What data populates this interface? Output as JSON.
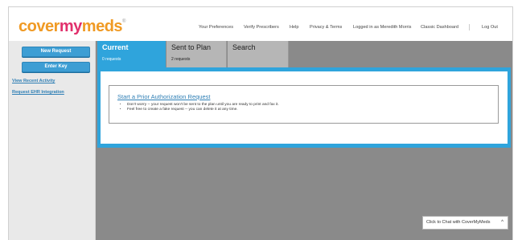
{
  "logo": {
    "part1": "cover",
    "part2": "my",
    "part3": "meds",
    "mark": "®"
  },
  "nav": {
    "preferences": "Your Preferences",
    "verify": "Verify Prescribers",
    "help": "Help",
    "privacy": "Privacy & Terms",
    "logged_in": "Logged in as Meredith Morris",
    "classic": "Classic Dashboard",
    "logout": "Log Out"
  },
  "sidebar": {
    "new_request": "New Request",
    "enter_key": "Enter Key",
    "view_recent": "View Recent Activity",
    "ehr": "Request EHR Integration"
  },
  "tabs": [
    {
      "title": "Current",
      "sub": "0 requests"
    },
    {
      "title": "Sent to Plan",
      "sub": "2 requests"
    },
    {
      "title": "Search",
      "sub": ""
    }
  ],
  "panel": {
    "link": "Start a Prior Authorization Request",
    "bullets": [
      "Don't worry -- your request won't be sent to the plan until you are ready to print and fax it.",
      "Feel free to create a fake request -- you can delete it at any time."
    ]
  },
  "chat": {
    "label": "Click to Chat with CoverMyMeds",
    "caret": "^"
  },
  "colors": {
    "accent": "#2fa4dc",
    "logo_orange": "#f09a24",
    "logo_pink": "#e1306c",
    "main_bg": "#8a8a8a"
  }
}
